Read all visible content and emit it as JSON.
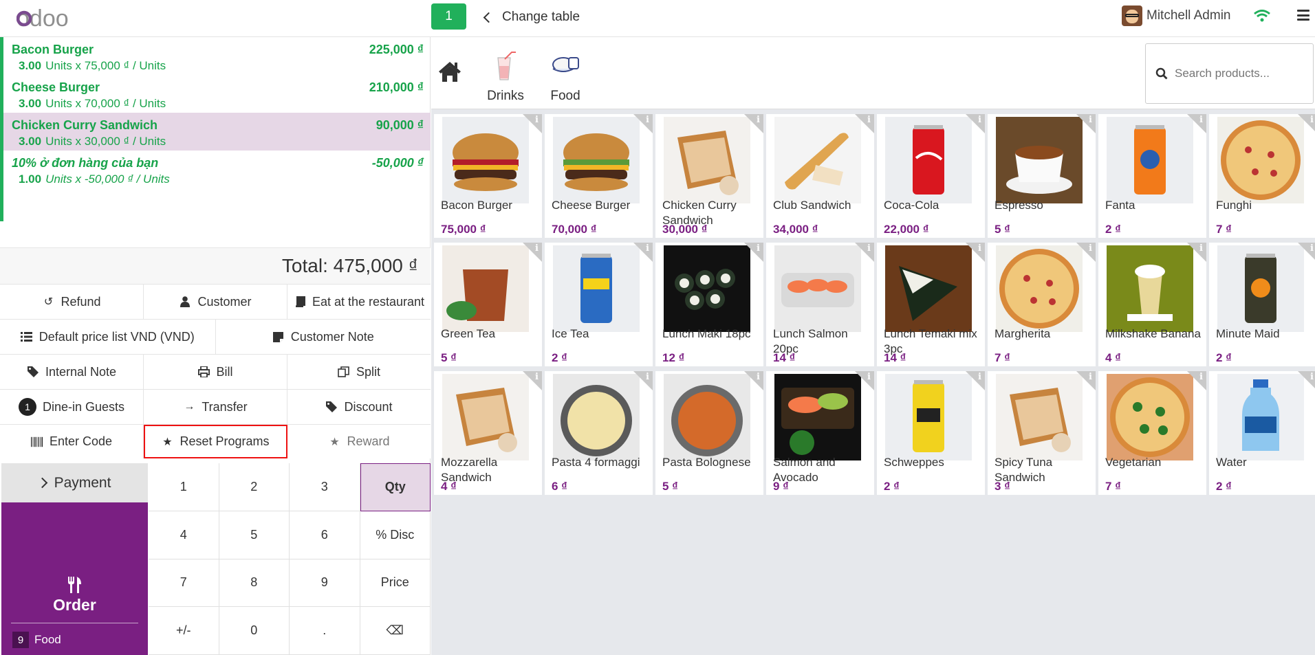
{
  "header": {
    "logo_text": "odoo",
    "table_number": "1",
    "change_table_label": "Change table",
    "user_name": "Mitchell Admin"
  },
  "order": {
    "lines": [
      {
        "name": "Bacon Burger",
        "qty": "3.00",
        "detail": "Units x 75,000 ₫ / Units",
        "price": "225,000 ₫",
        "selected": false,
        "reward": false
      },
      {
        "name": "Cheese Burger",
        "qty": "3.00",
        "detail": "Units x 70,000 ₫ / Units",
        "price": "210,000 ₫",
        "selected": false,
        "reward": false
      },
      {
        "name": "Chicken Curry Sandwich",
        "qty": "3.00",
        "detail": "Units x 30,000 ₫ / Units",
        "price": "90,000 ₫",
        "selected": true,
        "reward": false
      },
      {
        "name": "10% ở đơn hàng của bạn",
        "qty": "1.00",
        "detail": "Units x -50,000 ₫ / Units",
        "price": "-50,000 ₫",
        "selected": false,
        "reward": true
      }
    ],
    "total": "Total: 475,000 ₫"
  },
  "controls": {
    "refund": "Refund",
    "customer": "Customer",
    "eat_in": "Eat at the restaurant",
    "pricelist": "Default price list VND (VND)",
    "customer_note": "Customer Note",
    "internal_note": "Internal Note",
    "bill": "Bill",
    "split": "Split",
    "guests_count": "1",
    "dine_in_guests": "Dine-in Guests",
    "transfer": "Transfer",
    "discount": "Discount",
    "enter_code": "Enter Code",
    "reset_programs": "Reset Programs",
    "reward": "Reward"
  },
  "payment": {
    "label": "Payment",
    "order_label": "Order",
    "order_category_count": "9",
    "order_category": "Food"
  },
  "numpad": {
    "keys": [
      "1",
      "2",
      "3",
      "Qty",
      "4",
      "5",
      "6",
      "% Disc",
      "7",
      "8",
      "9",
      "Price",
      "+/-",
      "0",
      ".",
      "⌫"
    ],
    "active": "Qty"
  },
  "categories": [
    {
      "label": "Drinks"
    },
    {
      "label": "Food"
    }
  ],
  "search": {
    "placeholder": "Search products..."
  },
  "products": [
    {
      "name": "Bacon Burger",
      "price": "75,000 ₫",
      "kind": "burger-bacon"
    },
    {
      "name": "Cheese Burger",
      "price": "70,000 ₫",
      "kind": "burger"
    },
    {
      "name": "Chicken Curry Sandwich",
      "price": "30,000 ₫",
      "kind": "sandwich"
    },
    {
      "name": "Club Sandwich",
      "price": "34,000 ₫",
      "kind": "baguette"
    },
    {
      "name": "Coca-Cola",
      "price": "22,000 ₫",
      "kind": "can-red"
    },
    {
      "name": "Espresso",
      "price": "5 ₫",
      "kind": "espresso"
    },
    {
      "name": "Fanta",
      "price": "2 ₫",
      "kind": "can-orange"
    },
    {
      "name": "Funghi",
      "price": "7 ₫",
      "kind": "pizza"
    },
    {
      "name": "Green Tea",
      "price": "5 ₫",
      "kind": "tea"
    },
    {
      "name": "Ice Tea",
      "price": "2 ₫",
      "kind": "can-blue"
    },
    {
      "name": "Lunch Maki 18pc",
      "price": "12 ₫",
      "kind": "maki"
    },
    {
      "name": "Lunch Salmon 20pc",
      "price": "14 ₫",
      "kind": "salmon"
    },
    {
      "name": "Lunch Temaki mix 3pc",
      "price": "14 ₫",
      "kind": "temaki"
    },
    {
      "name": "Margherita",
      "price": "7 ₫",
      "kind": "pizza"
    },
    {
      "name": "Milkshake Banana",
      "price": "4 ₫",
      "kind": "milkshake"
    },
    {
      "name": "Minute Maid",
      "price": "2 ₫",
      "kind": "can-dark"
    },
    {
      "name": "Mozzarella Sandwich",
      "price": "4 ₫",
      "kind": "sandwich"
    },
    {
      "name": "Pasta 4 formaggi",
      "price": "6 ₫",
      "kind": "pasta"
    },
    {
      "name": "Pasta Bolognese",
      "price": "5 ₫",
      "kind": "pasta-red"
    },
    {
      "name": "Salmon and Avocado",
      "price": "9 ₫",
      "kind": "salmon-avo"
    },
    {
      "name": "Schweppes",
      "price": "2 ₫",
      "kind": "can-yellow"
    },
    {
      "name": "Spicy Tuna Sandwich",
      "price": "3 ₫",
      "kind": "sandwich"
    },
    {
      "name": "Vegetarian",
      "price": "7 ₫",
      "kind": "pizza-green"
    },
    {
      "name": "Water",
      "price": "2 ₫",
      "kind": "water"
    }
  ]
}
